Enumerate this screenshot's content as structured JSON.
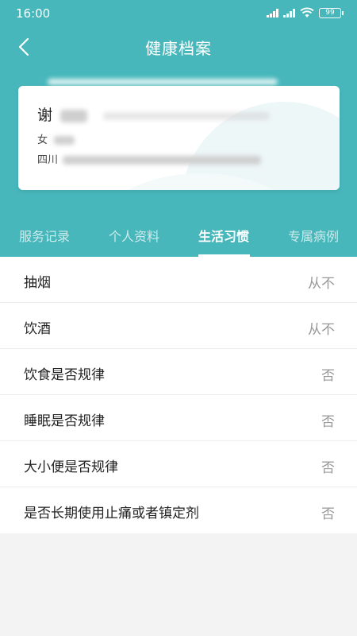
{
  "status_bar": {
    "time": "16:00",
    "battery": "99"
  },
  "nav": {
    "title": "健康档案"
  },
  "card": {
    "name_visible": "谢",
    "gender_visible": "女",
    "address_visible": "四川"
  },
  "tabs": [
    {
      "label": "服务记录",
      "active": false
    },
    {
      "label": "个人资料",
      "active": false
    },
    {
      "label": "生活习惯",
      "active": true
    },
    {
      "label": "专属病例",
      "active": false
    }
  ],
  "habits": [
    {
      "label": "抽烟",
      "value": "从不"
    },
    {
      "label": "饮酒",
      "value": "从不"
    },
    {
      "label": "饮食是否规律",
      "value": "否"
    },
    {
      "label": "睡眠是否规律",
      "value": "否"
    },
    {
      "label": "大小便是否规律",
      "value": "否"
    },
    {
      "label": "是否长期使用止痛或者镇定剂",
      "value": "否"
    }
  ],
  "colors": {
    "header": "#47b7bb",
    "background": "#f3f3f3"
  }
}
